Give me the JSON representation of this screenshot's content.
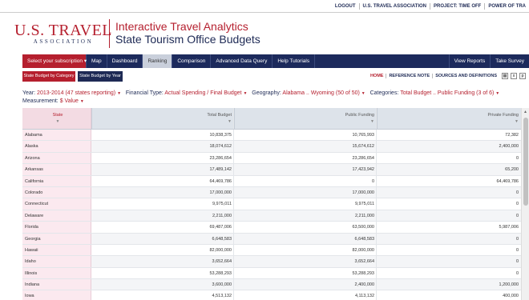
{
  "topbar": {
    "logout": "LOGOUT",
    "org": "U.S. TRAVEL ASSOCIATION",
    "project": "PROJECT: TIME OFF",
    "power": "POWER OF TRA"
  },
  "logo": {
    "line1": "U.S. TRAVEL",
    "line2": "ASSOCIATION"
  },
  "header": {
    "title": "Interactive Travel Analytics",
    "subtitle": "State Tourism Office Budgets"
  },
  "nav": {
    "subscription": "Select your subscription",
    "items": [
      "Map",
      "Dashboard",
      "Ranking",
      "Comparison",
      "Advanced Data Query",
      "Help Tutorials"
    ],
    "active": "Ranking",
    "right": [
      "View Reports",
      "Take Survey"
    ]
  },
  "toolbar": {
    "by_category": "State Budget by Category",
    "by_year": "State Budget by Year",
    "links": [
      "HOME",
      "REFERENCE NOTE",
      "SOURCES AND DEFINITIONS"
    ]
  },
  "filters": {
    "year_label": "Year:",
    "year_value": "2013-2014 (47 states reporting)",
    "ftype_label": "Financial Type:",
    "ftype_value": "Actual Spending / Final Budget",
    "geo_label": "Geography:",
    "geo_value": "Alabama .. Wyoming (50 of 50)",
    "cat_label": "Categories:",
    "cat_value": "Total Budget .. Public Funding (3 of 6)",
    "measure_label": "Measurement:",
    "measure_value": "$ Value"
  },
  "table": {
    "headers": [
      "State",
      "Total Budget",
      "Public Funding",
      "Private Funding"
    ],
    "rows": [
      [
        "Alabama",
        "10,838,375",
        "10,765,993",
        "72,382"
      ],
      [
        "Alaska",
        "18,074,612",
        "15,674,612",
        "2,400,000"
      ],
      [
        "Arizona",
        "23,286,654",
        "23,286,654",
        "0"
      ],
      [
        "Arkansas",
        "17,489,142",
        "17,423,942",
        "65,200"
      ],
      [
        "California",
        "64,469,786",
        "0",
        "64,469,786"
      ],
      [
        "Colorado",
        "17,000,000",
        "17,000,000",
        "0"
      ],
      [
        "Connecticut",
        "9,975,011",
        "9,975,011",
        "0"
      ],
      [
        "Delaware",
        "2,211,000",
        "2,211,000",
        "0"
      ],
      [
        "Florida",
        "69,487,006",
        "63,500,000",
        "5,987,006"
      ],
      [
        "Georgia",
        "6,648,583",
        "6,648,583",
        "0"
      ],
      [
        "Hawaii",
        "82,000,000",
        "82,000,000",
        "0"
      ],
      [
        "Idaho",
        "3,652,664",
        "3,652,664",
        "0"
      ],
      [
        "Illinois",
        "53,288,293",
        "53,288,293",
        "0"
      ],
      [
        "Indiana",
        "3,600,000",
        "2,400,000",
        "1,200,000"
      ],
      [
        "Iowa",
        "4,513,132",
        "4,113,132",
        "400,000"
      ]
    ]
  }
}
